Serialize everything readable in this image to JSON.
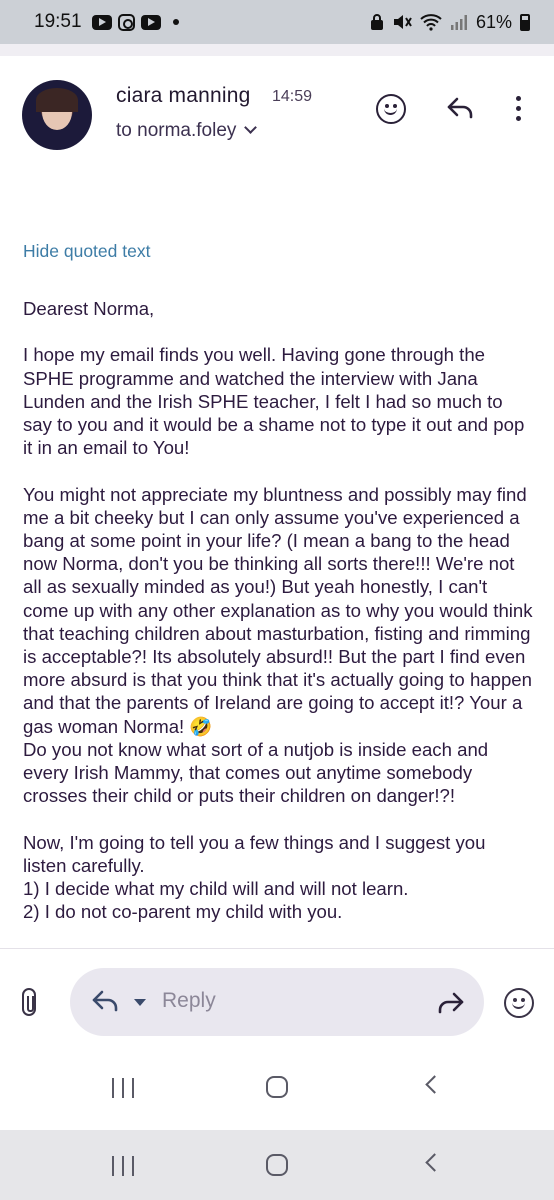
{
  "status_bar": {
    "time": "19:51",
    "battery": "61%"
  },
  "email": {
    "sender_name": "ciara manning",
    "time": "14:59",
    "recipient": "to norma.foley",
    "hide_quoted_label": "Hide quoted text",
    "body": "Dearest Norma,\n\nI hope my email finds you well. Having gone through the SPHE programme and watched the interview with Jana Lunden and the Irish SPHE teacher, I felt I had so much to say to you and it would be a shame not to type it out and pop it in an email to You!\n\nYou might not appreciate my bluntness and possibly may find me a bit cheeky but I can only assume you've experienced a bang at some point in your life? (I mean a bang to the head now Norma, don't you be thinking all sorts there!!! We're not all as sexually minded as you!) But yeah honestly, I can't come up with any other explanation as to why you would think that teaching children about masturbation, fisting and rimming is acceptable?! Its absolutely absurd!! But the part I find even more absurd is that you think that it's actually going to happen and that the parents of Ireland are going to accept it!? Your a gas woman Norma! 🤣\nDo you not know what sort of a nutjob is inside each and every Irish Mammy, that comes out anytime somebody crosses their child or puts their children on danger!?!\n\nNow, I'm going to tell you a few things and I suggest you listen carefully.\n1) I decide what my child will and will not learn.\n2) I do not co-parent my child with you."
  },
  "composer": {
    "reply_placeholder": "Reply"
  },
  "icons": {
    "header": [
      "emoji-icon",
      "reply-icon",
      "more-vert-icon"
    ],
    "composer": [
      "attach-icon",
      "reply-icon",
      "dropdown-caret-icon",
      "forward-icon",
      "emoji-icon"
    ],
    "nav": [
      "recents-icon",
      "home-icon",
      "back-icon"
    ]
  },
  "colors": {
    "link": "#3d7ca6",
    "text": "#2d1b3f",
    "status_bar": "#ccd0d6",
    "reply_pill": "#e9e7ef"
  }
}
